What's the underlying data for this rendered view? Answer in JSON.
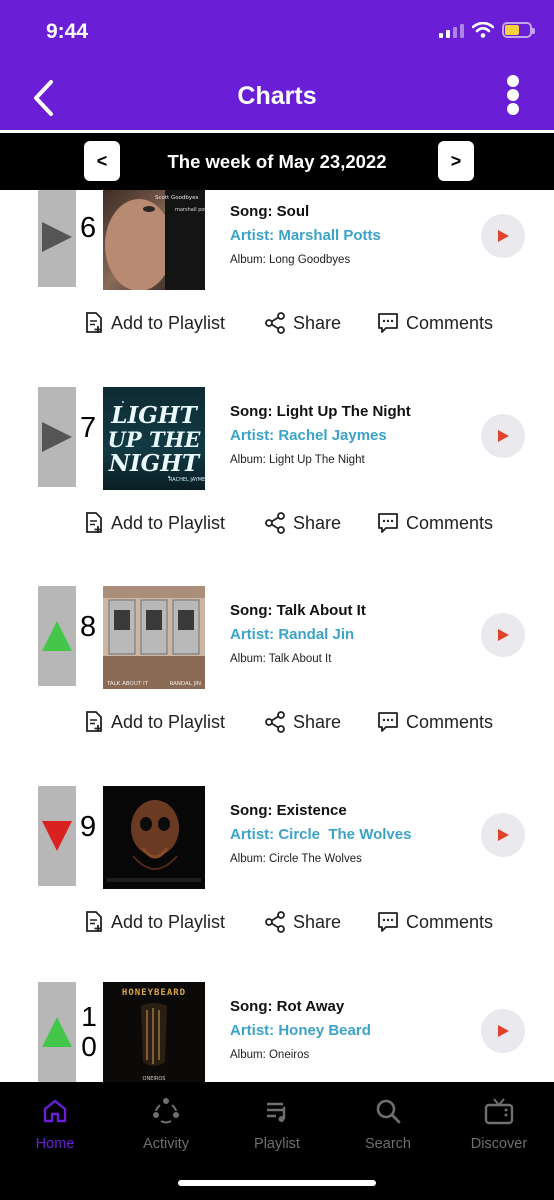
{
  "status": {
    "time": "9:44"
  },
  "nav": {
    "title": "Charts"
  },
  "week": {
    "prev_label": "<",
    "next_label": ">",
    "label": "The week of May 23,2022"
  },
  "colors": {
    "accent": "#6a1fd6",
    "artist": "#3ba3c9",
    "up": "#44c64a",
    "down": "#d9221f",
    "same": "#555555",
    "play": "#e0432b"
  },
  "actions": {
    "add": "Add to Playlist",
    "share": "Share",
    "comments": "Comments"
  },
  "items": [
    {
      "rank": "6",
      "trend": "same",
      "song": "Song: Soul",
      "artist": "Artist: Marshall Potts",
      "album": "Album: Long Goodbyes"
    },
    {
      "rank": "7",
      "trend": "same",
      "song": "Song: Light Up The Night",
      "artist": "Artist: Rachel Jaymes",
      "album": "Album: Light Up The Night"
    },
    {
      "rank": "8",
      "trend": "up",
      "song": "Song: Talk About It",
      "artist": "Artist: Randal Jin",
      "album": "Album: Talk About It"
    },
    {
      "rank": "9",
      "trend": "down",
      "song": "Song: Existence",
      "artist": "Artist: Circle  The Wolves",
      "album": "Album: Circle The Wolves"
    },
    {
      "rank": "10",
      "trend": "up",
      "song": "Song: Rot Away",
      "artist": "Artist: Honey Beard",
      "album": "Album: Oneiros"
    }
  ],
  "art_text": {
    "a6_top": "Scott Goodbyes",
    "a6_side": "marshall potts",
    "a7": "LIGHT UP THE NIGHT",
    "a7_small": "RACHEL JAYMES",
    "a8_left": "TALK ABOUT IT",
    "a8_right": "RANDAL JIN",
    "a10_top": "HONEYBEARD",
    "a10_bottom": "ONEIROS"
  },
  "tabs": [
    {
      "label": "Home",
      "icon": "home-icon",
      "active": true
    },
    {
      "label": "Activity",
      "icon": "activity-icon",
      "active": false
    },
    {
      "label": "Playlist",
      "icon": "playlist-icon",
      "active": false
    },
    {
      "label": "Search",
      "icon": "search-icon",
      "active": false
    },
    {
      "label": "Discover",
      "icon": "tv-icon",
      "active": false
    }
  ]
}
